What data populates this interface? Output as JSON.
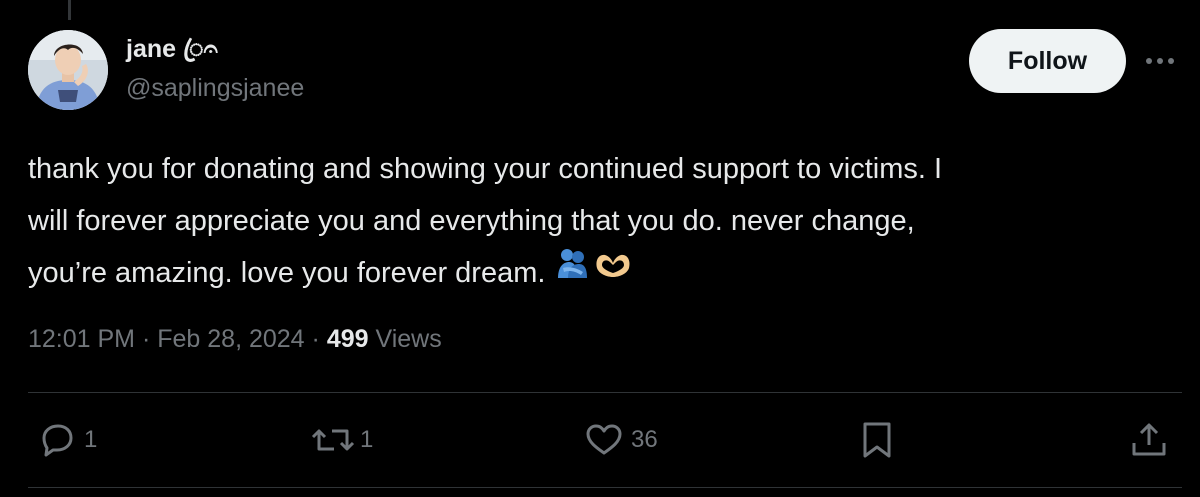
{
  "author": {
    "display_name": "jane",
    "name_badge": "ꦿ⁠𝄐",
    "handle": "@saplingsjanee"
  },
  "follow_label": "Follow",
  "more_icon": "more-horizontal-icon",
  "tweet": {
    "text": "thank you for donating and showing your continued support to victims. I\nwill forever appreciate you and everything that you do. never change,\nyou’re amazing. love you forever dream.",
    "emojis": [
      "people-hugging-emoji",
      "heart-hands-emoji"
    ]
  },
  "meta": {
    "time": "12:01 PM",
    "separator": "·",
    "date": "Feb 28, 2024",
    "views_count": "499",
    "views_label": "Views"
  },
  "actions": {
    "replies": "1",
    "reposts": "1",
    "likes": "36"
  },
  "colors": {
    "background": "#000000",
    "text_primary": "#e7e9ea",
    "text_secondary": "#71767b",
    "follow_bg": "#eff3f4",
    "divider": "#2f3336"
  }
}
